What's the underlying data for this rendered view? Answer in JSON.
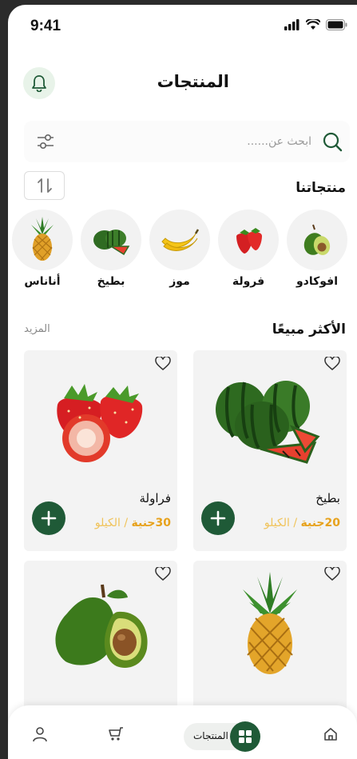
{
  "status_bar": {
    "time": "9:41"
  },
  "header": {
    "title": "المنتجات"
  },
  "search": {
    "placeholder": "ابحث عن......"
  },
  "products_section": {
    "title": "منتجاتنا",
    "categories": [
      {
        "label": "افوكادو",
        "icon": "avocado"
      },
      {
        "label": "فرولة",
        "icon": "strawberry"
      },
      {
        "label": "موز",
        "icon": "banana"
      },
      {
        "label": "بطيخ",
        "icon": "watermelon"
      },
      {
        "label": "أناناس",
        "icon": "pineapple"
      }
    ]
  },
  "best_sellers": {
    "title": "الأكثر مبيعًا",
    "more_label": "المزيد",
    "cards": [
      {
        "name": "بطيخ",
        "price": "20جنية",
        "unit": " / الكيلو",
        "icon": "watermelon"
      },
      {
        "name": "فراولة",
        "price": "30جنية",
        "unit": " / الكيلو",
        "icon": "strawberry"
      },
      {
        "name": "",
        "price": "",
        "unit": "",
        "icon": "pineapple"
      },
      {
        "name": "",
        "price": "",
        "unit": "",
        "icon": "avocado"
      }
    ]
  },
  "bottom_nav": {
    "active_label": "المنتجات",
    "items": [
      "home-icon",
      "grid-icon",
      "cart-icon",
      "profile-icon"
    ]
  },
  "colors": {
    "primary": "#1f5a37",
    "price": "#e7a21d",
    "card_bg": "#f3f3f3",
    "bell_bg": "#e8f3e9"
  }
}
